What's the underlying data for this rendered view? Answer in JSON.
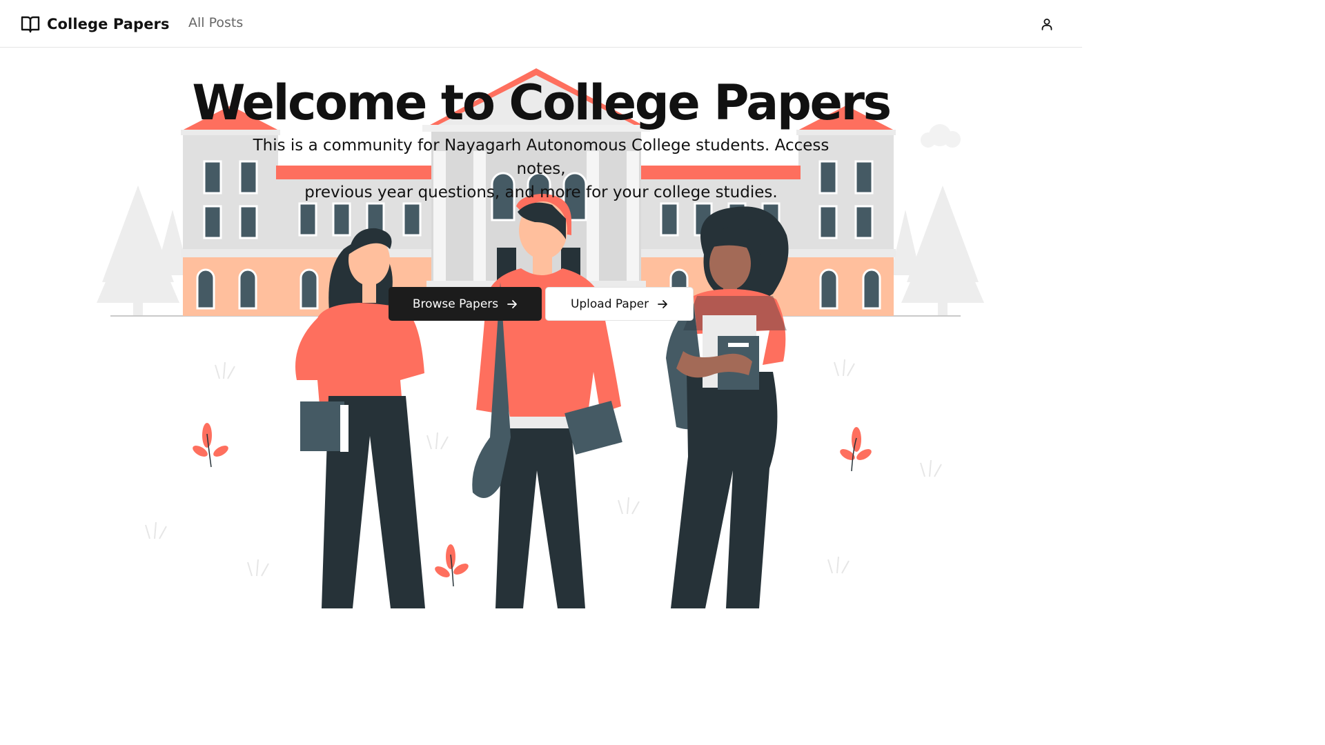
{
  "header": {
    "brand_name": "College Papers",
    "brand_icon": "open-book-icon",
    "nav": {
      "all_posts": "All Posts"
    },
    "user_icon": "user-icon"
  },
  "hero": {
    "title": "Welcome to College Papers",
    "subtitle_line1": "This is a community for Nayagarh Autonomous College students. Access notes,",
    "subtitle_line2": "previous year questions, and more for your college studies.",
    "primary_button": "Browse Papers",
    "secondary_button": "Upload Paper",
    "button_icon": "arrow-right-icon"
  },
  "colors": {
    "accent": "#fe6f5e",
    "peach": "#ffbf9d",
    "dark": "#263238",
    "building_gray": "#e0e0e0",
    "window_slate": "#455a64"
  }
}
